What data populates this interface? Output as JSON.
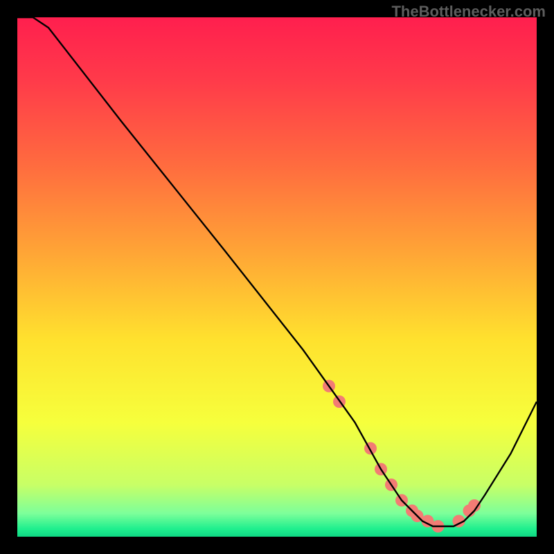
{
  "watermark": "TheBottlenecker.com",
  "chart_data": {
    "type": "line",
    "title": "",
    "xlabel": "",
    "ylabel": "",
    "xlim": [
      0,
      100
    ],
    "ylim": [
      0,
      100
    ],
    "x": [
      0,
      3,
      6,
      20,
      40,
      55,
      60,
      65,
      70,
      72,
      74,
      76,
      78,
      80,
      82,
      84,
      86,
      88,
      90,
      95,
      100
    ],
    "values": [
      100,
      100,
      98,
      80,
      55,
      36,
      29,
      22,
      13,
      10,
      7,
      5,
      3,
      2,
      2,
      2,
      3,
      5,
      8,
      16,
      26
    ],
    "markers_x": [
      60,
      62,
      68,
      70,
      72,
      74,
      76,
      77,
      79,
      81,
      85,
      87,
      88
    ],
    "markers_y": [
      29,
      26,
      17,
      13,
      10,
      7,
      5,
      4,
      3,
      2,
      3,
      5,
      6
    ],
    "marker_color": "#f27c74",
    "marker_radius": 9,
    "line_color": "#000000",
    "line_width": 2.4,
    "gradient_stops": [
      {
        "offset": 0.0,
        "color": "#ff1f4e"
      },
      {
        "offset": 0.12,
        "color": "#ff3a4a"
      },
      {
        "offset": 0.28,
        "color": "#ff6a3f"
      },
      {
        "offset": 0.45,
        "color": "#ffa436"
      },
      {
        "offset": 0.62,
        "color": "#ffe12e"
      },
      {
        "offset": 0.78,
        "color": "#f6ff3c"
      },
      {
        "offset": 0.9,
        "color": "#c8ff66"
      },
      {
        "offset": 0.955,
        "color": "#7dff9a"
      },
      {
        "offset": 0.985,
        "color": "#1fef8e"
      },
      {
        "offset": 1.0,
        "color": "#0fd884"
      }
    ]
  }
}
